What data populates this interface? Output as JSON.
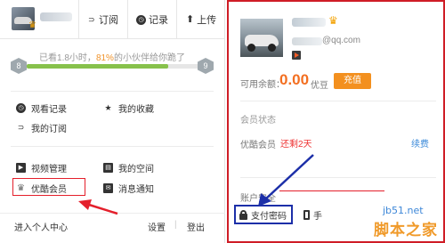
{
  "left_panel": {
    "tabs": [
      {
        "label": "订阅",
        "icon": "rss-icon"
      },
      {
        "label": "记录",
        "icon": "clock-icon"
      },
      {
        "label": "上传",
        "icon": "upload-icon"
      }
    ],
    "progress": {
      "text_before": "已看1.8小时，",
      "percent_text": "81%",
      "text_after": "的小伙伴给你跪了",
      "level_current": "8",
      "level_next": "9",
      "fraction": 0.82,
      "fill_color": "#87c14b"
    },
    "menu_group1": [
      {
        "label": "观看记录",
        "icon": "clock-icon"
      },
      {
        "label": "我的收藏",
        "icon": "star-icon"
      },
      {
        "label": "我的订阅",
        "icon": "rss-icon"
      }
    ],
    "menu_group2": [
      {
        "label": "视频管理",
        "icon": "video-icon"
      },
      {
        "label": "我的空间",
        "icon": "space-icon"
      },
      {
        "label": "优酷会员",
        "icon": "crown-icon"
      },
      {
        "label": "消息通知",
        "icon": "message-icon"
      }
    ],
    "footer": {
      "user_center": "进入个人中心",
      "settings": "设置",
      "logout": "登出"
    }
  },
  "right_panel": {
    "email_suffix": "@qq.com",
    "balance_label": "可用余额：",
    "balance_value": "0.00",
    "balance_unit": "优豆",
    "recharge_button": "充值",
    "member_section_title": "会员状态",
    "member_label": "优酷会员",
    "member_status": "还剩2天",
    "renew_link": "续费",
    "security_label": "账户安全",
    "pay_password": "支付密码",
    "phone_label": "手"
  },
  "watermark": {
    "domain": "jb51.net",
    "site_name": "脚本之家"
  },
  "colors": {
    "accent_orange": "#f3901f",
    "red_frame": "#cf1d26",
    "blue_highlight": "#1c2fa8",
    "link_blue": "#3b8ad9"
  }
}
